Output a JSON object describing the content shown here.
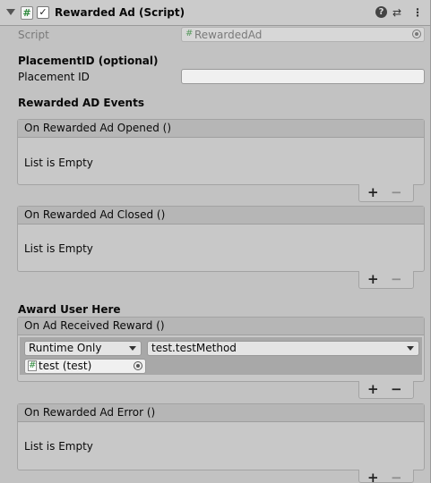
{
  "header": {
    "title": "Rewarded Ad (Script)",
    "script_icon": "#",
    "checkbox_mark": "✓",
    "help_icon": "?",
    "preset_icon": "⇄",
    "menu_icon": "⋮"
  },
  "script_field": {
    "label": "Script",
    "value": "RewardedAd",
    "hash": "#"
  },
  "placement": {
    "section_title": "PlacementID (optional)",
    "label": "Placement ID",
    "value": ""
  },
  "events_section_title": "Rewarded AD Events",
  "award_section_title": "Award User Here",
  "events": {
    "opened": {
      "title": "On Rewarded Ad Opened ()",
      "empty_text": "List is Empty"
    },
    "closed": {
      "title": "On Rewarded Ad Closed ()",
      "empty_text": "List is Empty"
    },
    "received": {
      "title": "On Ad Received Reward ()",
      "runtime": "Runtime Only",
      "function": "test.testMethod",
      "object": "test (test)",
      "object_hash": "#"
    },
    "error": {
      "title": "On Rewarded Ad Error ()",
      "empty_text": "List is Empty"
    }
  },
  "buttons": {
    "plus": "+",
    "minus": "−"
  }
}
